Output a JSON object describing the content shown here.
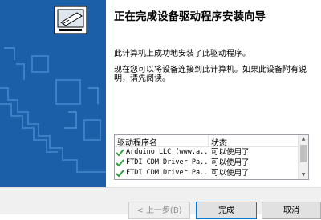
{
  "wizard": {
    "title": "正在完成设备驱动程序安装向导",
    "message1": "此计算机上成功地安装了此驱动程序。",
    "message2": "现在您可以将设备连接到此计算机。如果此设备附有说明，请先阅读。"
  },
  "driver_list": {
    "columns": [
      "驱动程序名",
      "状态"
    ],
    "rows": [
      {
        "name": "Arduino LLC (www.a...",
        "status": "可以使用了"
      },
      {
        "name": "FTDI CDM Driver Pa...",
        "status": "可以使用了"
      },
      {
        "name": "FTDI CDM Driver Pa...",
        "status": "可以使用了"
      }
    ]
  },
  "buttons": {
    "back": "< 上一步(B)",
    "finish": "完成",
    "cancel": "取消"
  },
  "colors": {
    "banner": "#1a5fa8",
    "check": "#2e9d3a",
    "focus_border": "#0078d7"
  }
}
